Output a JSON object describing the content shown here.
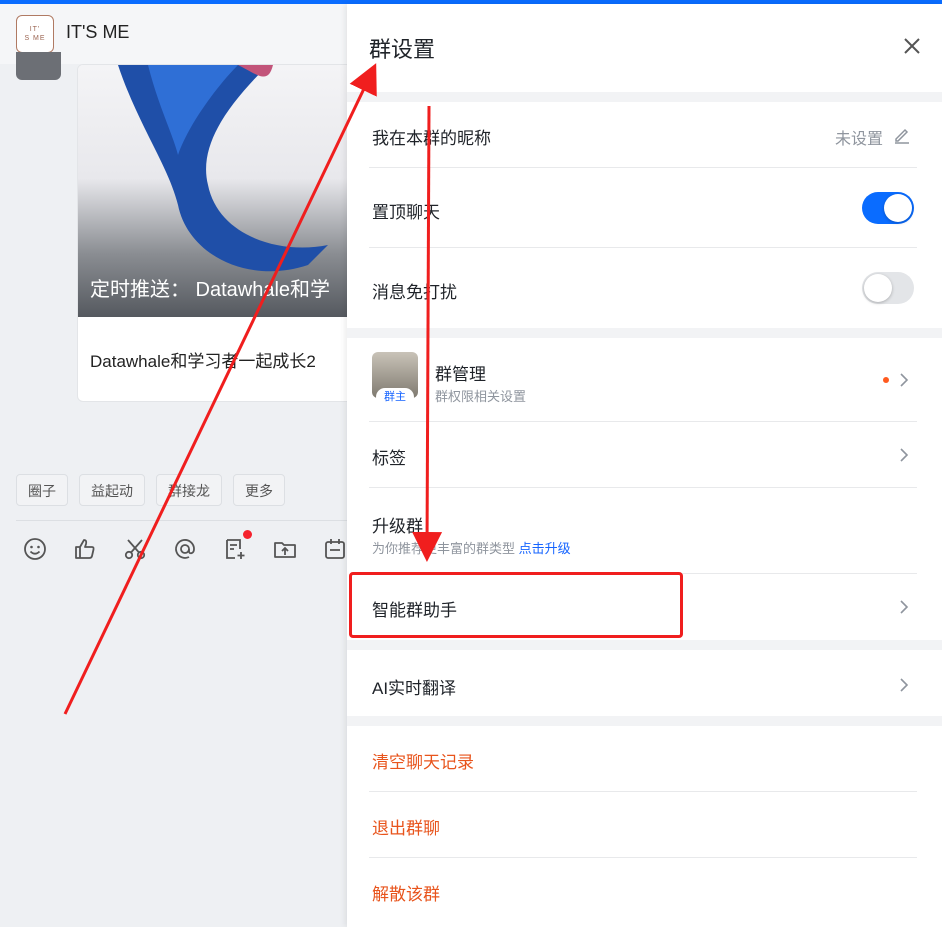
{
  "chat": {
    "logo_line1": "IT'",
    "logo_line2": "S ME",
    "title": "IT'S ME",
    "card_overlay_text": "定时推送： Datawhale和学",
    "card_caption": "Datawhale和学习者一起成长2",
    "chips": [
      "圈子",
      "益起动",
      "群接龙",
      "更多"
    ],
    "toolbar_icons": [
      "emoji-icon",
      "thumbs-up-icon",
      "scissors-icon",
      "at-icon",
      "add-note-icon",
      "upload-icon",
      "calendar-icon"
    ]
  },
  "panel": {
    "title": "群设置",
    "nickname_label": "我在本群的昵称",
    "nickname_value": "未设置",
    "pin_chat_label": "置顶聊天",
    "pin_chat_on": true,
    "mute_label": "消息免打扰",
    "mute_on": false,
    "manage_label": "群管理",
    "manage_sub": "群权限相关设置",
    "owner_badge": "群主",
    "tags_label": "标签",
    "upgrade_label": "升级群",
    "upgrade_sub": "为你推荐更丰富的群类型",
    "upgrade_link": "点击升级",
    "assistant_label": "智能群助手",
    "translate_label": "AI实时翻译",
    "clear_label": "清空聊天记录",
    "exit_label": "退出群聊",
    "dissolve_label": "解散该群"
  },
  "colors": {
    "accent": "#0a6cff",
    "toggle_on": "#0a6cff",
    "danger": "#e8541c",
    "annotation_red": "#f01e1e"
  }
}
